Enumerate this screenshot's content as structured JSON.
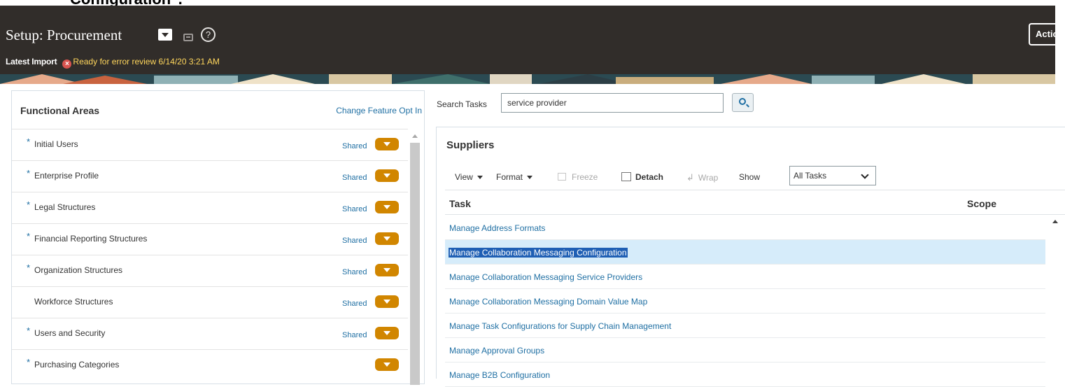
{
  "top_cropped_text": "Configuration\".",
  "header": {
    "title": "Setup: Procurement",
    "actions_label": "Actions",
    "latest_import_label": "Latest Import",
    "import_status": "Ready for error review 6/14/20 3:21 AM"
  },
  "functional_areas": {
    "title": "Functional Areas",
    "change_link": "Change Feature Opt In",
    "star": "*",
    "items": [
      {
        "label": "Initial Users",
        "required": true,
        "shared": "Shared"
      },
      {
        "label": "Enterprise Profile",
        "required": true,
        "shared": "Shared"
      },
      {
        "label": "Legal Structures",
        "required": true,
        "shared": "Shared"
      },
      {
        "label": "Financial Reporting Structures",
        "required": true,
        "shared": "Shared"
      },
      {
        "label": "Organization Structures",
        "required": true,
        "shared": "Shared"
      },
      {
        "label": "Workforce Structures",
        "required": false,
        "shared": "Shared"
      },
      {
        "label": "Users and Security",
        "required": true,
        "shared": "Shared"
      },
      {
        "label": "Purchasing Categories",
        "required": true,
        "shared": ""
      }
    ]
  },
  "search": {
    "label": "Search Tasks",
    "value": "service provider"
  },
  "suppliers": {
    "title": "Suppliers",
    "toolbar": {
      "view": "View",
      "format": "Format",
      "freeze": "Freeze",
      "detach": "Detach",
      "wrap": "Wrap",
      "show": "Show",
      "show_value": "All Tasks"
    },
    "columns": {
      "task": "Task",
      "scope": "Scope"
    },
    "tasks": [
      {
        "label": "Manage Address Formats",
        "selected": false
      },
      {
        "label": "Manage Collaboration Messaging Configuration",
        "selected": true
      },
      {
        "label": "Manage Collaboration Messaging Service Providers",
        "selected": false
      },
      {
        "label": "Manage Collaboration Messaging Domain Value Map",
        "selected": false
      },
      {
        "label": "Manage Task Configurations for Supply Chain Management",
        "selected": false
      },
      {
        "label": "Manage Approval Groups",
        "selected": false
      },
      {
        "label": "Manage B2B Configuration",
        "selected": false
      }
    ]
  },
  "colors": {
    "header_bg": "#312d2a",
    "link": "#1f6fa3",
    "status_yellow": "#ffd65c",
    "pill_orange": "#d18600",
    "selected_row": "#d6ecfa"
  }
}
